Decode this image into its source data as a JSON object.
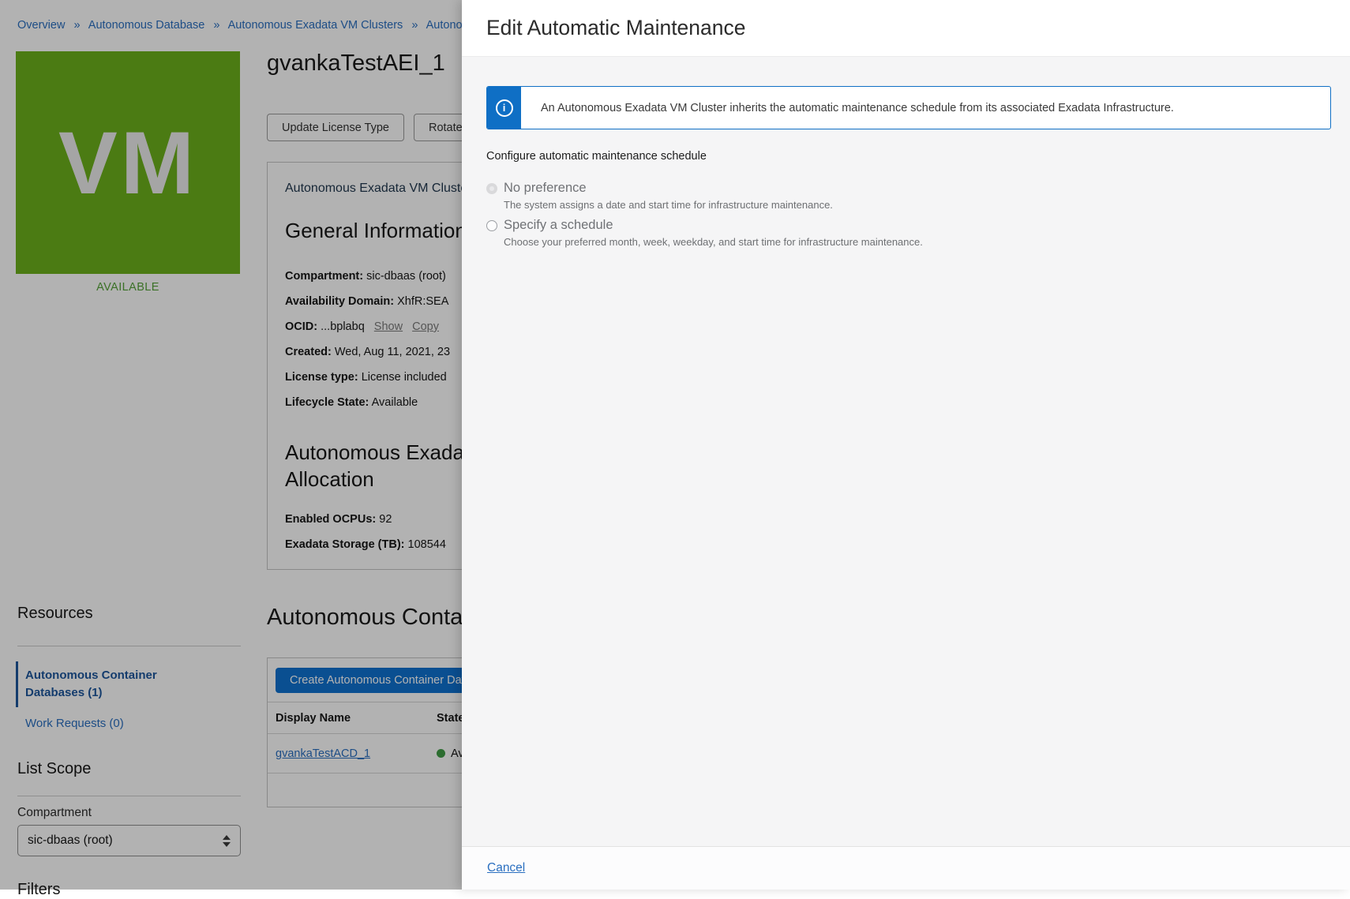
{
  "breadcrumb": {
    "separator": "»",
    "items": [
      "Overview",
      "Autonomous Database",
      "Autonomous Exadata VM Clusters",
      "Autonomous Exadata VM Cluster Details"
    ]
  },
  "entity": {
    "tile_label": "VM",
    "status": "AVAILABLE",
    "title": "gvankaTestAEI_1"
  },
  "actions": {
    "update_license": "Update License Type",
    "rotate_certs": "Rotate ORDS Certs"
  },
  "details_card": {
    "tab": "Autonomous Exadata VM Cluster Information",
    "general": {
      "heading": "General Information",
      "fields": [
        {
          "label": "Compartment:",
          "value": "sic-dbaas (root)"
        },
        {
          "label": "Availability Domain:",
          "value": "XhfR:SEA"
        },
        {
          "label": "OCID:",
          "value": "...bplabq"
        },
        {
          "label": "Created:",
          "value": "Wed, Aug 11, 2021, 23"
        },
        {
          "label": "License type:",
          "value": "License included"
        },
        {
          "label": "Lifecycle State:",
          "value": "Available"
        }
      ],
      "ocid_links": {
        "show": "Show",
        "copy": "Copy"
      }
    },
    "allocation": {
      "heading_line1": "Autonomous Exadata",
      "heading_line2": "Allocation",
      "fields": [
        {
          "label": "Enabled OCPUs:",
          "value": "92"
        },
        {
          "label": "Exadata Storage (TB):",
          "value": "108544"
        }
      ]
    }
  },
  "acd_section": {
    "heading": "Autonomous Container Databases",
    "create_button": "Create Autonomous Container Database",
    "columns": [
      "Display Name",
      "State"
    ],
    "row": {
      "display_name": "gvankaTestACD_1",
      "state": "Available"
    }
  },
  "sidebar": {
    "resources": {
      "heading": "Resources",
      "items": [
        {
          "label": "Autonomous Container Databases (1)"
        },
        {
          "label": "Work Requests (0)"
        }
      ]
    },
    "list_scope": {
      "heading": "List Scope",
      "compartment_label": "Compartment",
      "compartment_value": "sic-dbaas (root)"
    },
    "filters_heading": "Filters"
  },
  "panel": {
    "title": "Edit Automatic Maintenance",
    "info_banner": "An Autonomous Exadata VM Cluster inherits the automatic maintenance schedule from its associated Exadata Infrastructure.",
    "schedule_label": "Configure automatic maintenance schedule",
    "options": [
      {
        "label": "No preference",
        "description": "The system assigns a date and start time for infrastructure maintenance.",
        "selected": true,
        "disabled": true
      },
      {
        "label": "Specify a schedule",
        "description": "Choose your preferred month, week, weekday, and start time for infrastructure maintenance.",
        "selected": false,
        "disabled": false
      }
    ],
    "cancel_label": "Cancel"
  },
  "colors": {
    "tile_green": "#6cb01c",
    "status_green": "#55a339",
    "state_dot_green": "#3f9c45",
    "primary_button_blue": "#0f72d0",
    "info_banner_blue": "#0f6fc5",
    "link_blue": "#2a6fc0",
    "active_nav_blue": "#1d569d"
  }
}
